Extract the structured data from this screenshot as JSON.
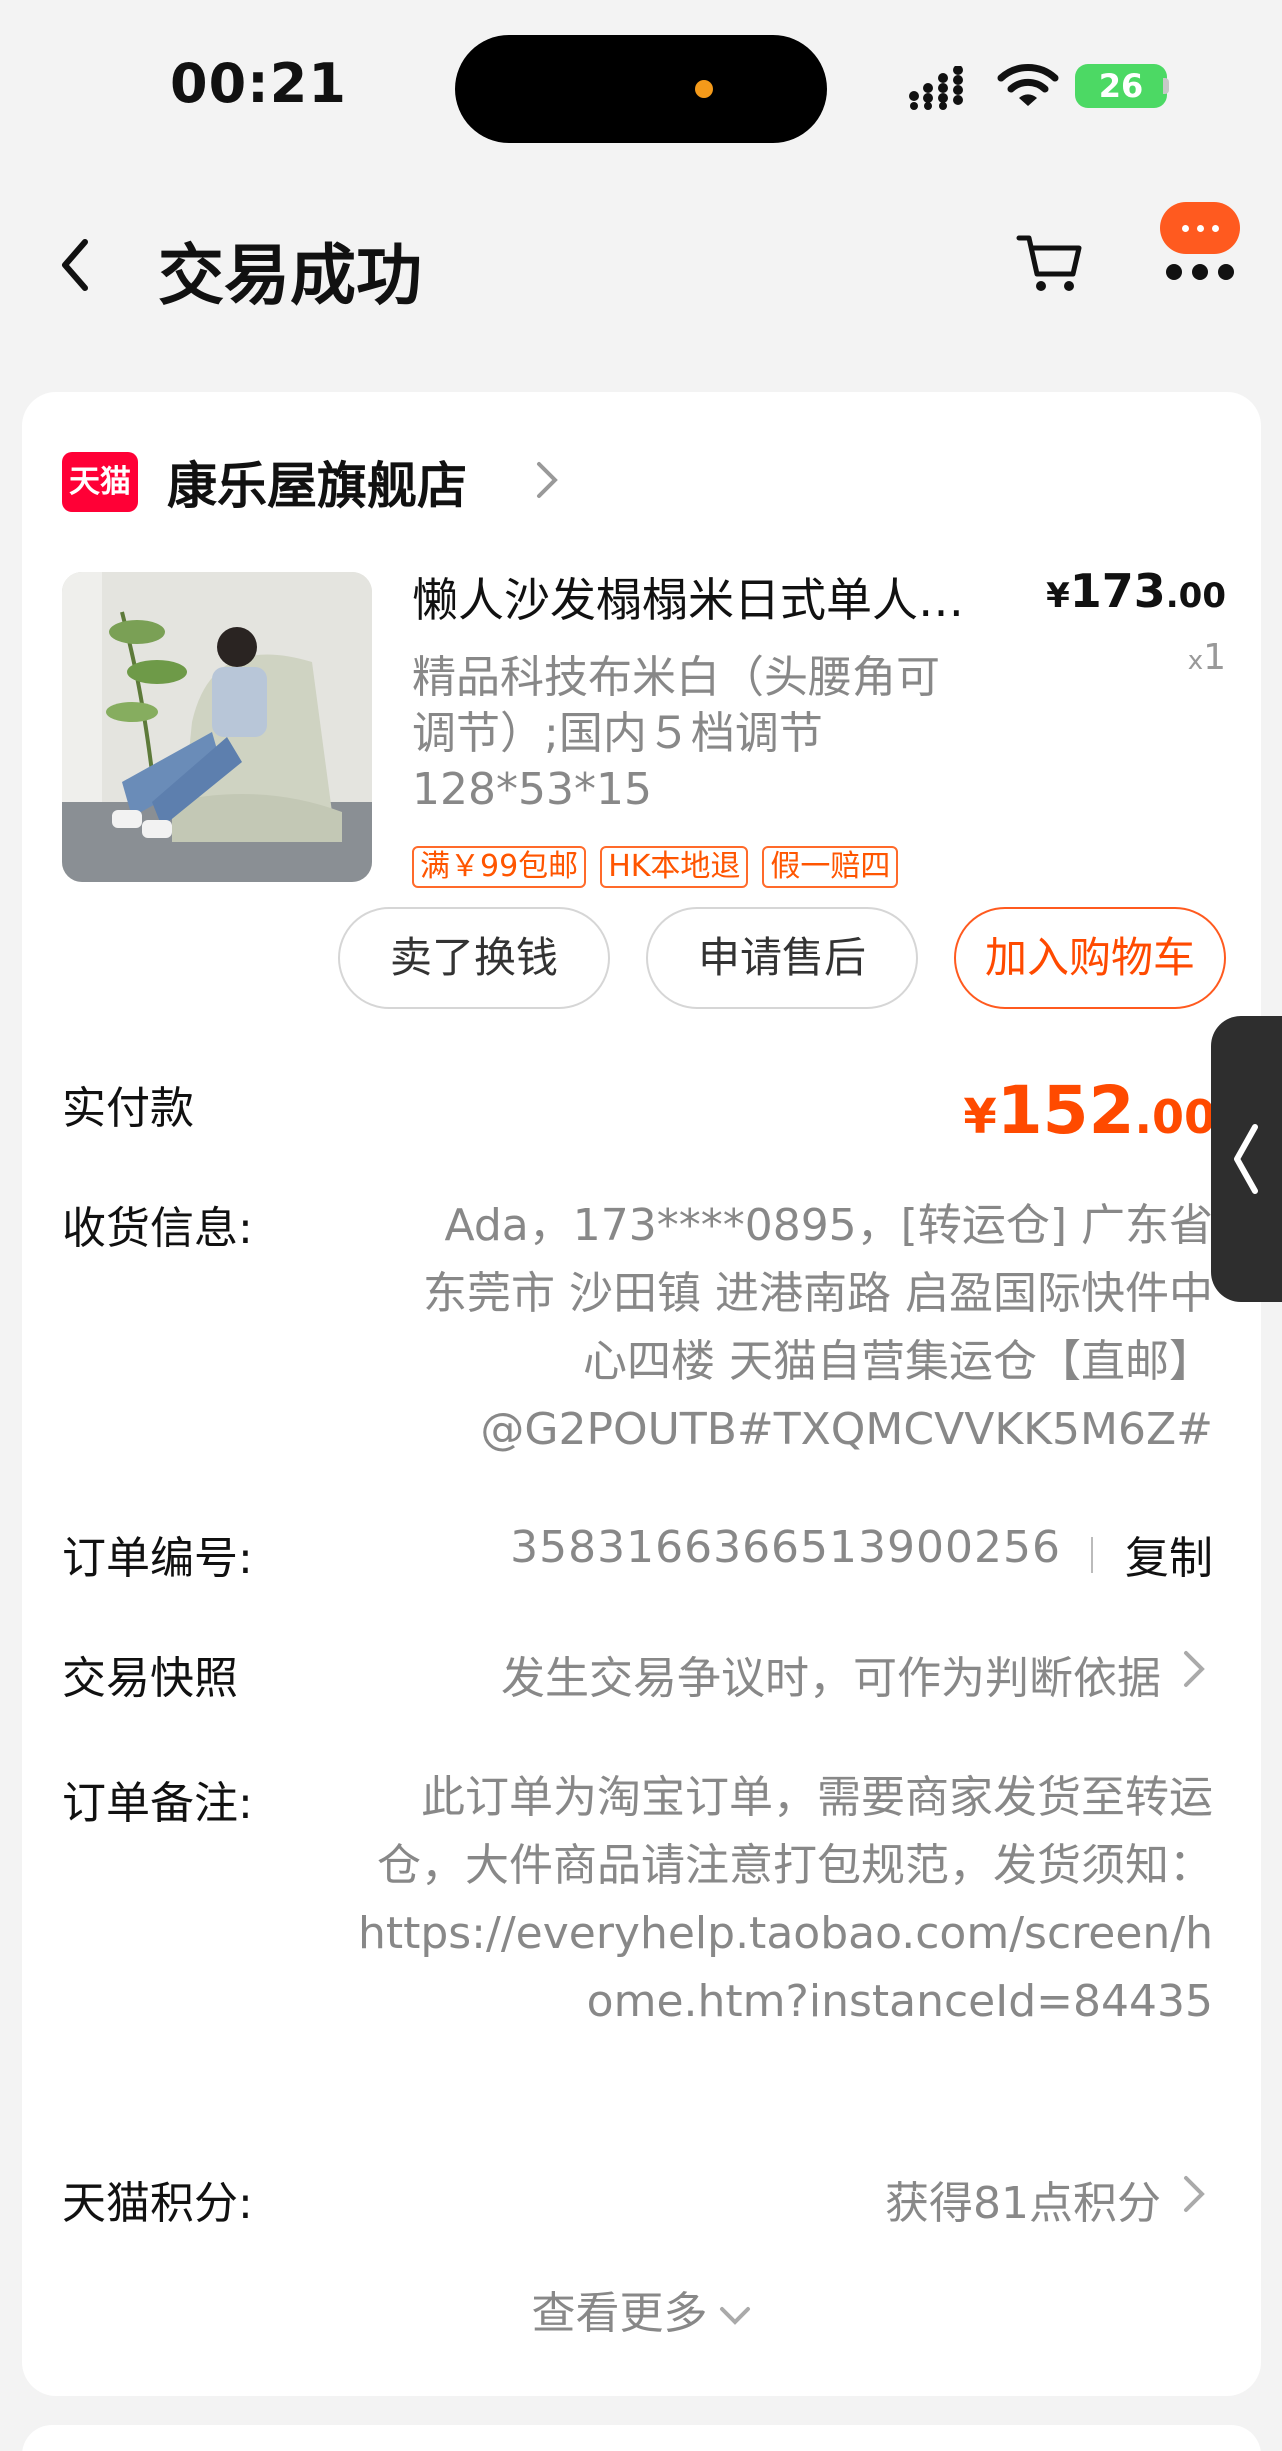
{
  "status_bar": {
    "time": "00:21",
    "battery": "26"
  },
  "nav": {
    "title": "交易成功"
  },
  "store": {
    "badge": "天猫",
    "name": "康乐屋旗舰店"
  },
  "product": {
    "title": "懒人沙发榻榻米日式单人…",
    "price_main": "173",
    "price_decimal": ".00",
    "currency": "¥",
    "qty_prefix": "x",
    "qty": "1",
    "spec_line1": "精品科技布米白（头腰角可",
    "spec_line2": "调节）;国内５档调节",
    "spec_line3": "128*53*15",
    "tags": [
      "满￥99包邮",
      "HK本地退",
      "假一赔四"
    ]
  },
  "actions": {
    "sell": "卖了换钱",
    "after_sale": "申请售后",
    "add_cart": "加入购物车"
  },
  "payment": {
    "label": "实付款",
    "currency": "¥",
    "amount_main": "152",
    "amount_decimal": ".00"
  },
  "address": {
    "label": "收货信息:",
    "value": "Ada，173****0895，[转运仓] 广东省东莞市 沙田镇 进港南路 启盈国际快件中心四楼 天猫自营集运仓【直邮】@G2POUTB#TXQMCVVKK5M6Z#"
  },
  "order": {
    "label": "订单编号:",
    "number": "3583166366513900256",
    "copy": "复制"
  },
  "snapshot": {
    "label": "交易快照",
    "value": "发生交易争议时，可作为判断依据"
  },
  "note": {
    "label": "订单备注:",
    "value": "此订单为淘宝订单，需要商家发货至转运仓，大件商品请注意打包规范，发货须知：https://everyhelp.taobao.com/screen/home.htm?instanceId=84435"
  },
  "points": {
    "label": "天猫积分:",
    "value": "获得81点积分"
  },
  "more": {
    "label": "查看更多"
  },
  "colors": {
    "accent": "#ff4a00",
    "tmall_red": "#ff0036",
    "battery_green": "#4cd964"
  }
}
